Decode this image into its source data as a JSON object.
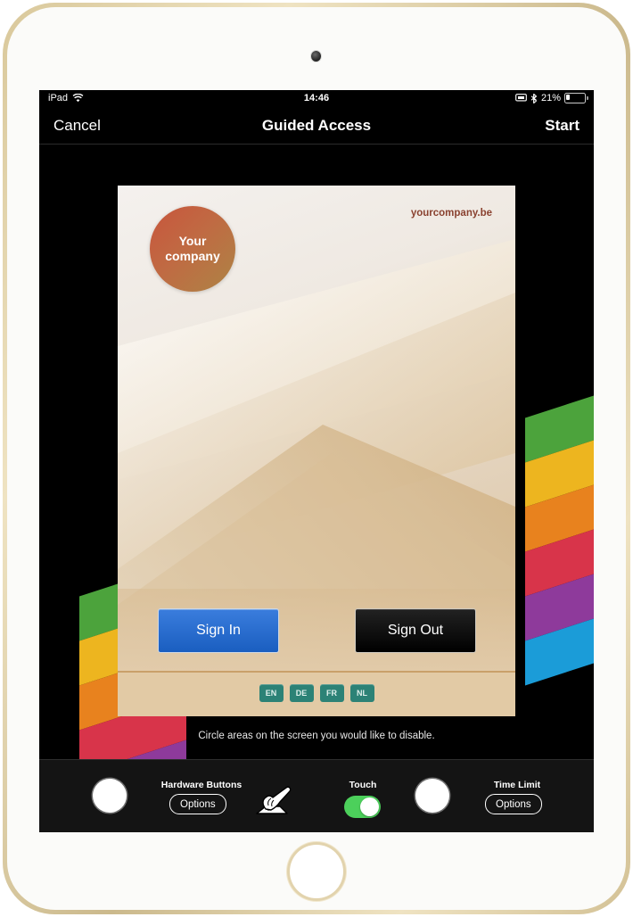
{
  "device": {
    "name": "iPad",
    "camera": "front-camera",
    "home_button": "home-button"
  },
  "statusbar": {
    "carrier": "iPad",
    "wifi_icon": "wifi-icon",
    "time": "14:46",
    "mirror_icon": "screen-mirroring-icon",
    "bluetooth_icon": "bluetooth-icon",
    "battery_percent": "21%",
    "battery_icon": "battery-low-icon"
  },
  "navbar": {
    "cancel_label": "Cancel",
    "title": "Guided Access",
    "start_label": "Start"
  },
  "app": {
    "logo_line1": "Your",
    "logo_line2": "company",
    "website": "yourcompany.be",
    "sign_in_label": "Sign In",
    "sign_out_label": "Sign Out",
    "languages": [
      "EN",
      "DE",
      "FR",
      "NL"
    ]
  },
  "hint": "Circle areas on the screen you would like to disable.",
  "toolbar": {
    "hardware_buttons_label": "Hardware Buttons",
    "hardware_options_label": "Options",
    "touch_icon": "hand-tap-icon",
    "touch_label": "Touch",
    "touch_enabled": true,
    "time_limit_label": "Time Limit",
    "time_limit_options_label": "Options"
  },
  "colors": {
    "stripes": [
      "#4ca33c",
      "#edb51f",
      "#e8821e",
      "#d8344a",
      "#8e3a9b",
      "#1b9cd8"
    ],
    "accent_blue": "#1a5ec0",
    "toggle_green": "#4cd05b",
    "lang_teal": "#2c8276",
    "brand_red": "#8a4230",
    "bezel_gold": "#d9c89b"
  }
}
